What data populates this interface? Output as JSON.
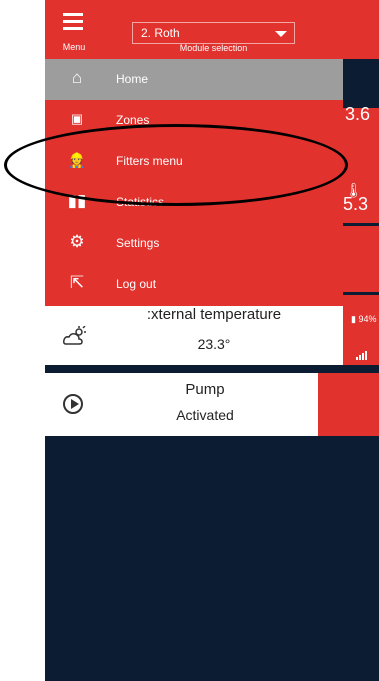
{
  "topbar": {
    "menu_label": "Menu",
    "module_value": "2. Roth",
    "module_label": "Module selection"
  },
  "menu": {
    "items": [
      {
        "label": "Home",
        "icon": "home-icon",
        "active": true
      },
      {
        "label": "Zones",
        "icon": "zones-icon",
        "active": false
      },
      {
        "label": "Fitters menu",
        "icon": "fitter-icon",
        "active": false
      },
      {
        "label": "Statistics",
        "icon": "statistics-icon",
        "active": false
      },
      {
        "label": "Settings",
        "icon": "settings-icon",
        "active": false
      },
      {
        "label": "Log out",
        "icon": "logout-icon",
        "active": false
      }
    ]
  },
  "background": {
    "zone_temp_fragment": "3.6",
    "zone_temp_fragment2": "5.3",
    "battery_pct": "94%"
  },
  "external": {
    "title": ":xternal temperature",
    "value": "23.3°"
  },
  "pump": {
    "title": "Pump",
    "status": "Activated"
  },
  "colors": {
    "accent_red": "#e2322e",
    "dark_bg": "#0c1d33",
    "active_item": "#9d9d9d"
  }
}
